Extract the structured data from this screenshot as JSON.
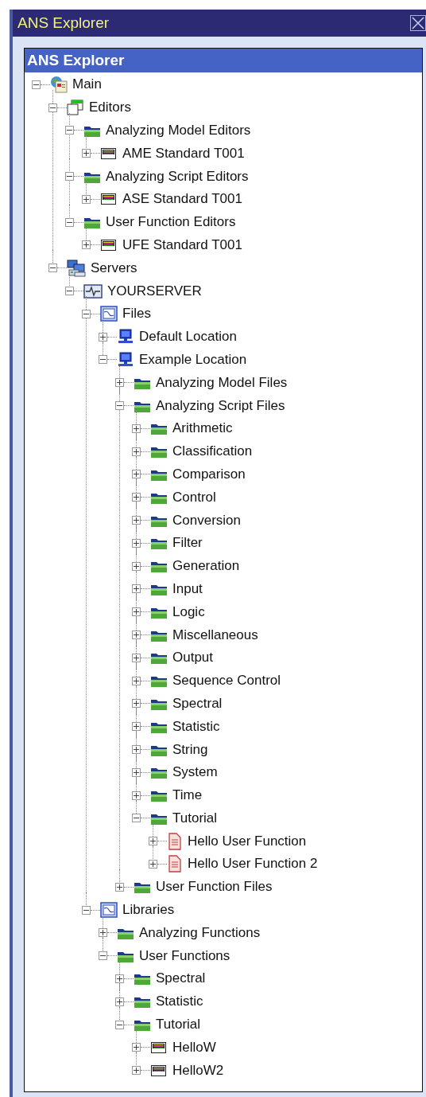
{
  "window": {
    "title": "ANS Explorer"
  },
  "panel": {
    "title": "ANS Explorer"
  },
  "tree": [
    {
      "label": "Main",
      "kind": "globe",
      "expanded": true,
      "children": [
        {
          "label": "Editors",
          "kind": "window",
          "expanded": true,
          "children": [
            {
              "label": "Analyzing Model Editors",
              "kind": "folder",
              "expanded": true,
              "children": [
                {
                  "label": "AME Standard T001",
                  "kind": "strip",
                  "expanded": false
                }
              ]
            },
            {
              "label": "Analyzing Script Editors",
              "kind": "folder",
              "expanded": true,
              "children": [
                {
                  "label": "ASE Standard T001",
                  "kind": "strip",
                  "expanded": false
                }
              ]
            },
            {
              "label": "User Function Editors",
              "kind": "folder",
              "expanded": true,
              "children": [
                {
                  "label": "UFE Standard T001",
                  "kind": "strip",
                  "expanded": false
                }
              ]
            }
          ]
        },
        {
          "label": "Servers",
          "kind": "servers",
          "expanded": true,
          "children": [
            {
              "label": "YOURSERVER",
              "kind": "server",
              "expanded": true,
              "children": [
                {
                  "label": "Files",
                  "kind": "chart",
                  "expanded": true,
                  "children": [
                    {
                      "label": "Default Location",
                      "kind": "computer",
                      "expanded": false
                    },
                    {
                      "label": "Example Location",
                      "kind": "computer",
                      "expanded": true,
                      "children": [
                        {
                          "label": "Analyzing Model Files",
                          "kind": "folder",
                          "expanded": false
                        },
                        {
                          "label": "Analyzing Script Files",
                          "kind": "folder",
                          "expanded": true,
                          "children": [
                            {
                              "label": "Arithmetic",
                              "kind": "folder",
                              "expanded": false
                            },
                            {
                              "label": "Classification",
                              "kind": "folder",
                              "expanded": false
                            },
                            {
                              "label": "Comparison",
                              "kind": "folder",
                              "expanded": false
                            },
                            {
                              "label": "Control",
                              "kind": "folder",
                              "expanded": false
                            },
                            {
                              "label": "Conversion",
                              "kind": "folder",
                              "expanded": false
                            },
                            {
                              "label": "Filter",
                              "kind": "folder",
                              "expanded": false
                            },
                            {
                              "label": "Generation",
                              "kind": "folder",
                              "expanded": false
                            },
                            {
                              "label": "Input",
                              "kind": "folder",
                              "expanded": false
                            },
                            {
                              "label": "Logic",
                              "kind": "folder",
                              "expanded": false
                            },
                            {
                              "label": "Miscellaneous",
                              "kind": "folder",
                              "expanded": false
                            },
                            {
                              "label": "Output",
                              "kind": "folder",
                              "expanded": false
                            },
                            {
                              "label": "Sequence Control",
                              "kind": "folder",
                              "expanded": false
                            },
                            {
                              "label": "Spectral",
                              "kind": "folder",
                              "expanded": false
                            },
                            {
                              "label": "Statistic",
                              "kind": "folder",
                              "expanded": false
                            },
                            {
                              "label": "String",
                              "kind": "folder",
                              "expanded": false
                            },
                            {
                              "label": "System",
                              "kind": "folder",
                              "expanded": false
                            },
                            {
                              "label": "Time",
                              "kind": "folder",
                              "expanded": false
                            },
                            {
                              "label": "Tutorial",
                              "kind": "folder",
                              "expanded": true,
                              "children": [
                                {
                                  "label": "Hello User Function",
                                  "kind": "document",
                                  "expanded": false
                                },
                                {
                                  "label": "Hello User Function 2",
                                  "kind": "document",
                                  "expanded": false
                                }
                              ]
                            }
                          ]
                        },
                        {
                          "label": "User Function Files",
                          "kind": "folder",
                          "expanded": false
                        }
                      ]
                    }
                  ]
                },
                {
                  "label": "Libraries",
                  "kind": "chart",
                  "expanded": true,
                  "children": [
                    {
                      "label": "Analyzing Functions",
                      "kind": "folder",
                      "expanded": false
                    },
                    {
                      "label": "User Functions",
                      "kind": "folder",
                      "expanded": true,
                      "children": [
                        {
                          "label": "Spectral",
                          "kind": "folder",
                          "expanded": false
                        },
                        {
                          "label": "Statistic",
                          "kind": "folder",
                          "expanded": false
                        },
                        {
                          "label": "Tutorial",
                          "kind": "folder",
                          "expanded": true,
                          "children": [
                            {
                              "label": "HelloW",
                              "kind": "strip",
                              "expanded": false
                            },
                            {
                              "label": "HelloW2",
                              "kind": "strip",
                              "expanded": false
                            }
                          ]
                        }
                      ]
                    }
                  ]
                }
              ]
            }
          ]
        }
      ]
    }
  ]
}
